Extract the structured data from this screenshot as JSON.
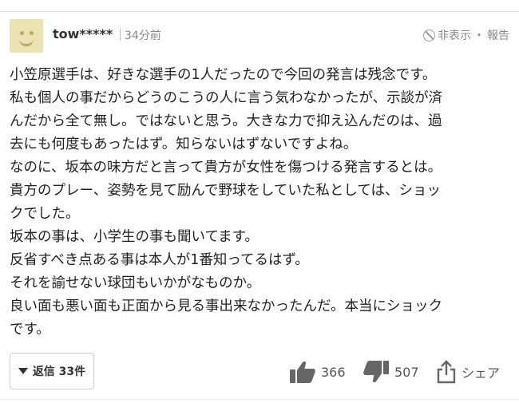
{
  "comment": {
    "username": "tow*****",
    "time": "34分前",
    "hide_label": "非表示",
    "separator": "・",
    "report_label": "報告",
    "body_lines": [
      "小笠原選手は、好きな選手の1人だったので今回の発言は残念です。",
      "私も個人の事だからどうのこうの人に言う気わなかったが、示談が済",
      "んだから全て無し。ではないと思う。大きな力で抑え込んだのは、過",
      "去にも何度もあったはず。知らないはずないですよね。",
      "なのに、坂本の味方だと言って貴方が女性を傷つける発言するとは。",
      "貴方のプレー、姿勢を見て励んで野球をしていた私としては、ショッ",
      "クでした。",
      "坂本の事は、小学生の事も聞いてます。",
      "反省すべき点ある事は本人が1番知ってるはず。",
      "それを諭せない球団もいかがなものか。",
      "良い面も悪い面も正面から見る事出来なかったんだ。本当にショック",
      "です。"
    ],
    "reply_label": "返信 33件",
    "like_count": "366",
    "dislike_count": "507",
    "share_label": "シェア"
  },
  "colors": {
    "avatar_bg": "#ebe3b3",
    "text": "#222222",
    "muted": "#888888",
    "icon": "#666666"
  }
}
